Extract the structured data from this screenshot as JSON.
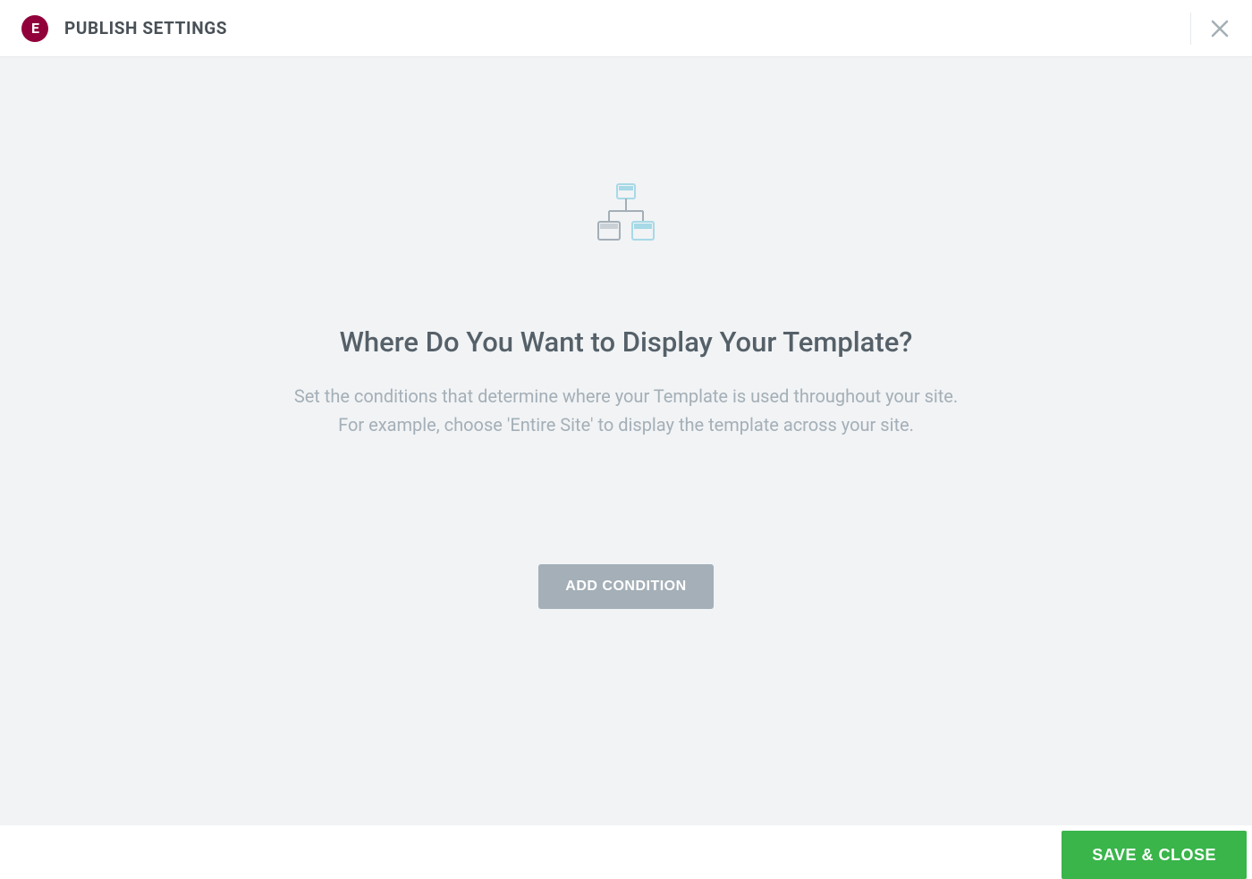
{
  "header": {
    "logo_text": "E",
    "title": "PUBLISH SETTINGS"
  },
  "main": {
    "heading": "Where Do You Want to Display Your Template?",
    "subtext_line1": "Set the conditions that determine where your Template is used throughout your site.",
    "subtext_line2": "For example, choose 'Entire Site' to display the template across your site.",
    "add_condition_label": "ADD CONDITION"
  },
  "footer": {
    "save_label": "SAVE & CLOSE"
  }
}
